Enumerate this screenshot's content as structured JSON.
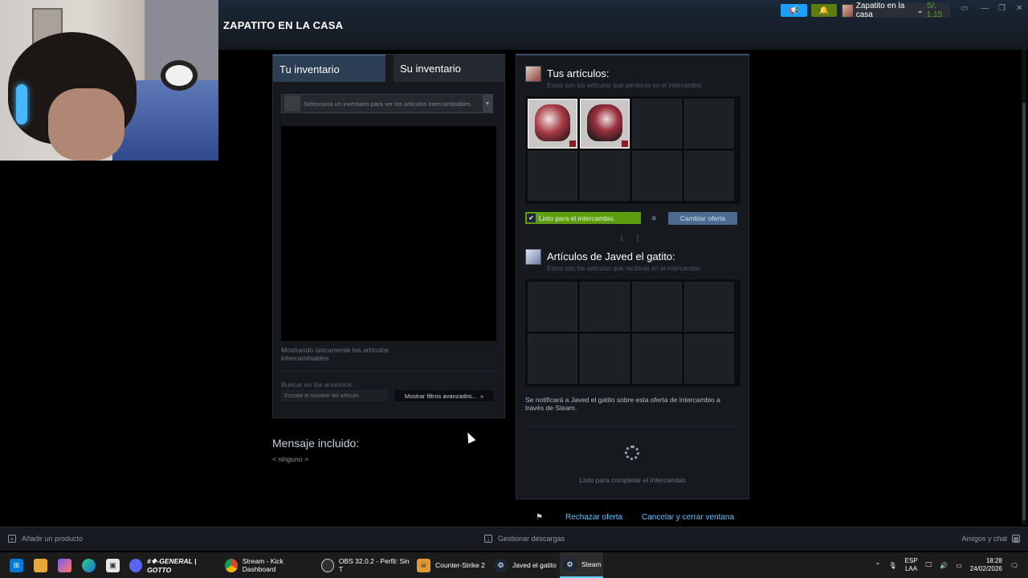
{
  "header": {
    "title": "ZAPATITO EN LA CASA",
    "account_name": "Zapatito en la casa",
    "balance": "S/. 1.15"
  },
  "inventory": {
    "tab_mine": "Tu inventario",
    "tab_theirs": "Su inventario",
    "select_placeholder": "Selecciona un inventario para ver los artículos intercambiables",
    "note": "Mostrando únicamente los artículos intercambiables",
    "search_label": "Buscar en los anuncios:",
    "search_placeholder": "Escribe el nombre del artículo",
    "advanced_filters": "Mostrar filtros avanzados..."
  },
  "message": {
    "title": "Mensaje incluido:",
    "value": "< ninguno >"
  },
  "trade": {
    "my_title": "Tus artículos:",
    "my_sub": "Estos son los artículos que perderás en el intercambio",
    "ready_label": "Listo para el intercambio.",
    "or_label": "o",
    "change_offer": "Cambiar oferta",
    "their_title": "Artículos de Javed el gatito:",
    "their_sub": "Estos son los artículos que recibirás en el intercambio",
    "notify": "Se notificará a Javed el gatito sobre esta oferta de intercambio a través de Steam.",
    "status": "Listo para completar el intercambio",
    "reject": "Rechazar oferta",
    "cancel": "Cancelar y cerrar ventana"
  },
  "footer": {
    "add_product": "Añadir un producto",
    "manage_downloads": "Gestionar descargas",
    "friends_chat": "Amigos y chat"
  },
  "taskbar": {
    "apps": [
      {
        "label": "#❖-GENERAL | GOTTO",
        "icon": "discord-icon",
        "color": "#5865f2"
      },
      {
        "label": "Stream - Kick Dashboard",
        "icon": "chrome-icon",
        "color": "#db4437"
      },
      {
        "label": "OBS 32.0.2 - Perfil: Sin T",
        "icon": "obs-icon",
        "color": "#302e31"
      },
      {
        "label": "Counter-Strike 2",
        "icon": "cs2-icon",
        "color": "#de9b35"
      },
      {
        "label": "Javed el gatito",
        "icon": "steam-icon",
        "color": "#1b2838"
      },
      {
        "label": "Steam",
        "icon": "steam-icon",
        "color": "#1b2838"
      }
    ],
    "lang_top": "ESP",
    "lang_bottom": "LAA",
    "time": "18:28",
    "date": "24/02/2026"
  }
}
